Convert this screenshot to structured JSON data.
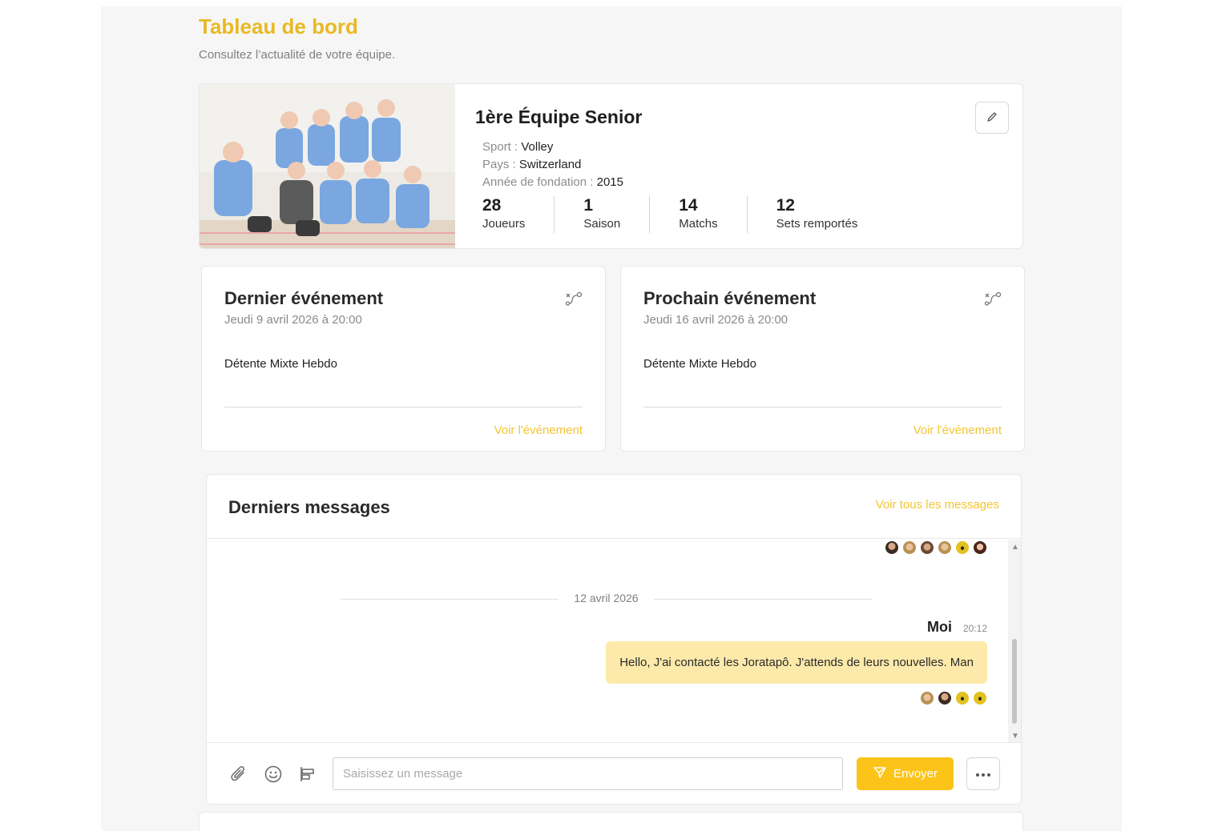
{
  "header": {
    "title": "Tableau de bord",
    "subtitle": "Consultez l’actualité de votre équipe."
  },
  "team": {
    "name": "1ère Équipe Senior",
    "sport_label": "Sport :",
    "sport": "Volley",
    "country_label": "Pays :",
    "country": "Switzerland",
    "founded_label": "Année de fondation :",
    "founded": "2015",
    "stats": [
      {
        "value": "28",
        "label": "Joueurs"
      },
      {
        "value": "1",
        "label": "Saison"
      },
      {
        "value": "14",
        "label": "Matchs"
      },
      {
        "value": "12",
        "label": "Sets remportés"
      }
    ],
    "edit_icon": "pencil-icon"
  },
  "events": {
    "last": {
      "title": "Dernier événement",
      "date": "Jeudi 9 avril 2026 à 20:00",
      "name": "Détente Mixte Hebdo",
      "link": "Voir l'événement"
    },
    "next": {
      "title": "Prochain événement",
      "date": "Jeudi 16 avril 2026 à 20:00",
      "name": "Détente Mixte Hebdo",
      "link": "Voir l'événement"
    },
    "icon": "route-icon"
  },
  "messages": {
    "title": "Derniers messages",
    "view_all": "Voir tous les messages",
    "date_separator": "12 avril 2026",
    "sender": "Moi",
    "time": "20:12",
    "text": "Hello, J'ai contacté les Joratapô. J'attends de leurs nouvelles. Man",
    "composer": {
      "placeholder": "Saisissez un message",
      "send_label": "Envoyer"
    }
  },
  "colors": {
    "accent": "#fcc419",
    "title": "#e8b923",
    "bubble": "#fdeaaa"
  }
}
